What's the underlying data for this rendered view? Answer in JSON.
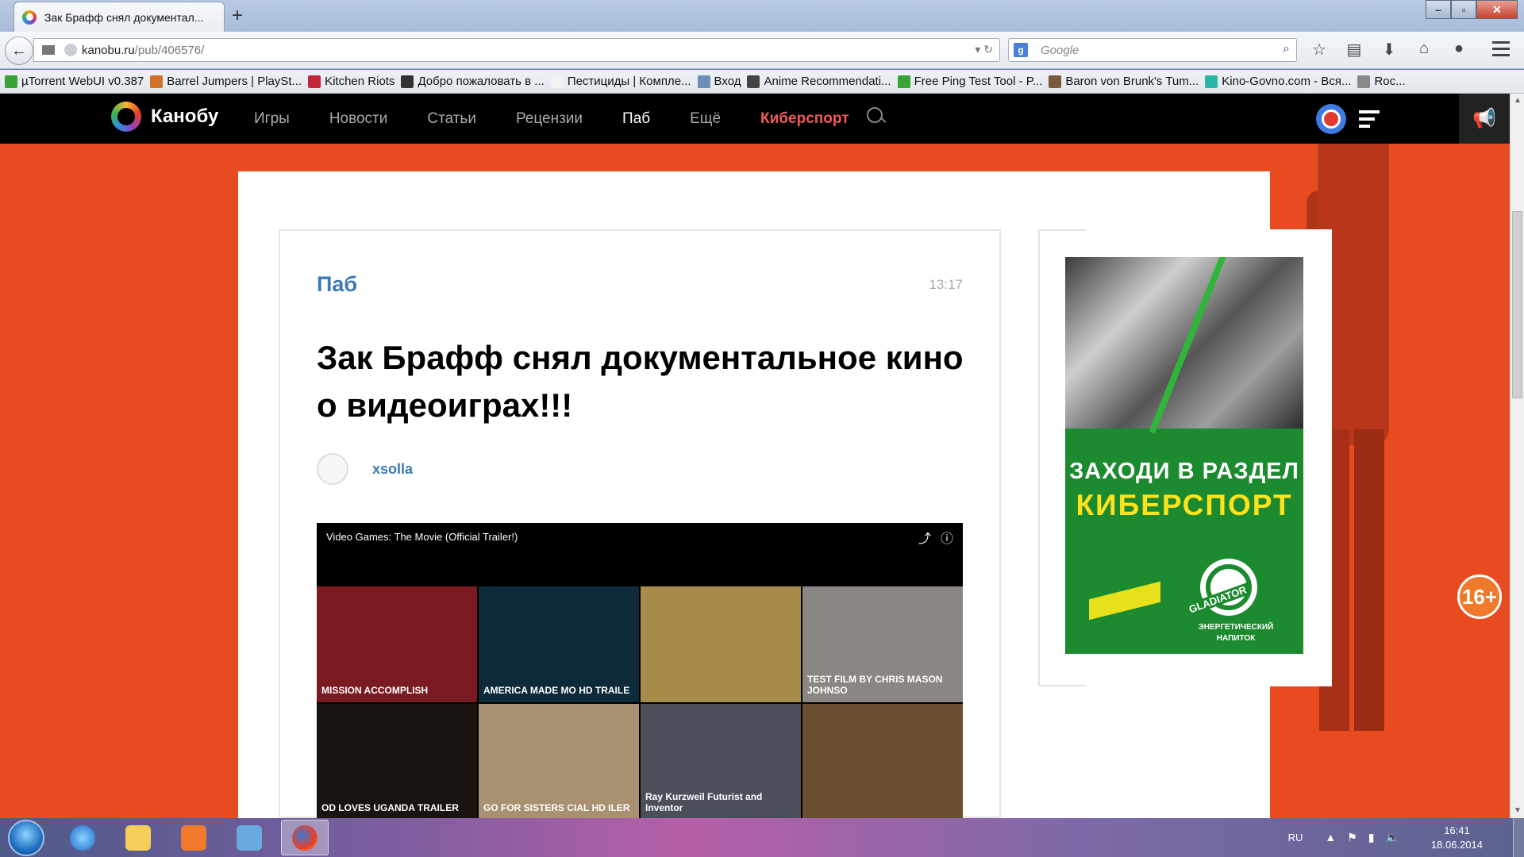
{
  "browser": {
    "tab_title": "Зак Брафф снял документал...",
    "new_tab": "+",
    "url_host": "kanobu.ru",
    "url_path": "/pub/406576/",
    "search_placeholder": "Google"
  },
  "bookmarks": [
    {
      "label": "µTorrent WebUI v0.387",
      "color": "#3aa335"
    },
    {
      "label": "Barrel Jumpers | PlaySt...",
      "color": "#d0702a"
    },
    {
      "label": "Kitchen Riots",
      "color": "#c2273a"
    },
    {
      "label": "Добро пожаловать в ...",
      "color": "#333333"
    },
    {
      "label": "Пестициды | Компле...",
      "color": "#f2f2f2"
    },
    {
      "label": "Вход",
      "color": "#6a8fb8"
    },
    {
      "label": "Anime Recommendati...",
      "color": "#444444"
    },
    {
      "label": "Free Ping Test Tool - P...",
      "color": "#3aa335"
    },
    {
      "label": "Baron von Brunk's Tum...",
      "color": "#7a5a3a"
    },
    {
      "label": "Kino-Govno.com - Вся...",
      "color": "#2bb5a5"
    },
    {
      "label": "Roc...",
      "color": "#888888"
    }
  ],
  "site": {
    "logo": "Канобу",
    "nav": [
      "Игры",
      "Новости",
      "Статьи",
      "Рецензии",
      "Паб",
      "Ещё",
      "Киберспорт"
    ],
    "age_badge": "16+"
  },
  "article": {
    "category": "Паб",
    "time": "13:17",
    "headline": "Зак Брафф снял документальное кино о видеоиграх!!!",
    "author": "xsolla",
    "video_title": "Video Games: The Movie (Official Trailer!)",
    "thumbs": [
      {
        "text": "MISSION ACCOMPLISH",
        "bg": "#7a1a22"
      },
      {
        "text": "AMERICA MADE MO HD TRAILE",
        "bg": "#0d2a3a"
      },
      {
        "text": "",
        "bg": "#a88a4a"
      },
      {
        "text": "TEST FILM BY CHRIS MASON JOHNSO",
        "bg": "#8a8682"
      },
      {
        "text": "OD LOVES UGANDA TRAILER",
        "bg": "#1a1410"
      },
      {
        "text": "GO FOR SISTERS CIAL HD ILER",
        "bg": "#a89070"
      },
      {
        "text": "Ray Kurzweil Futurist and Inventor",
        "bg": "#4a4f5a"
      },
      {
        "text": "",
        "bg": "#6a5030"
      }
    ]
  },
  "ad": {
    "line1": "ЗАХОДИ В РАЗДЕЛ",
    "line2": "КИБЕРСПОРТ",
    "brand": "GLADIATOR",
    "energy": "ЭНЕРГЕТИЧЕСКИЙ НАПИТОК"
  },
  "taskbar": {
    "lang": "RU",
    "time": "16:41",
    "date": "18.06.2014"
  },
  "colors": {
    "accent": "#e94b21",
    "link": "#3d79b4",
    "cyber": "#ef5a5a",
    "ad_green": "#1c8a2e"
  }
}
